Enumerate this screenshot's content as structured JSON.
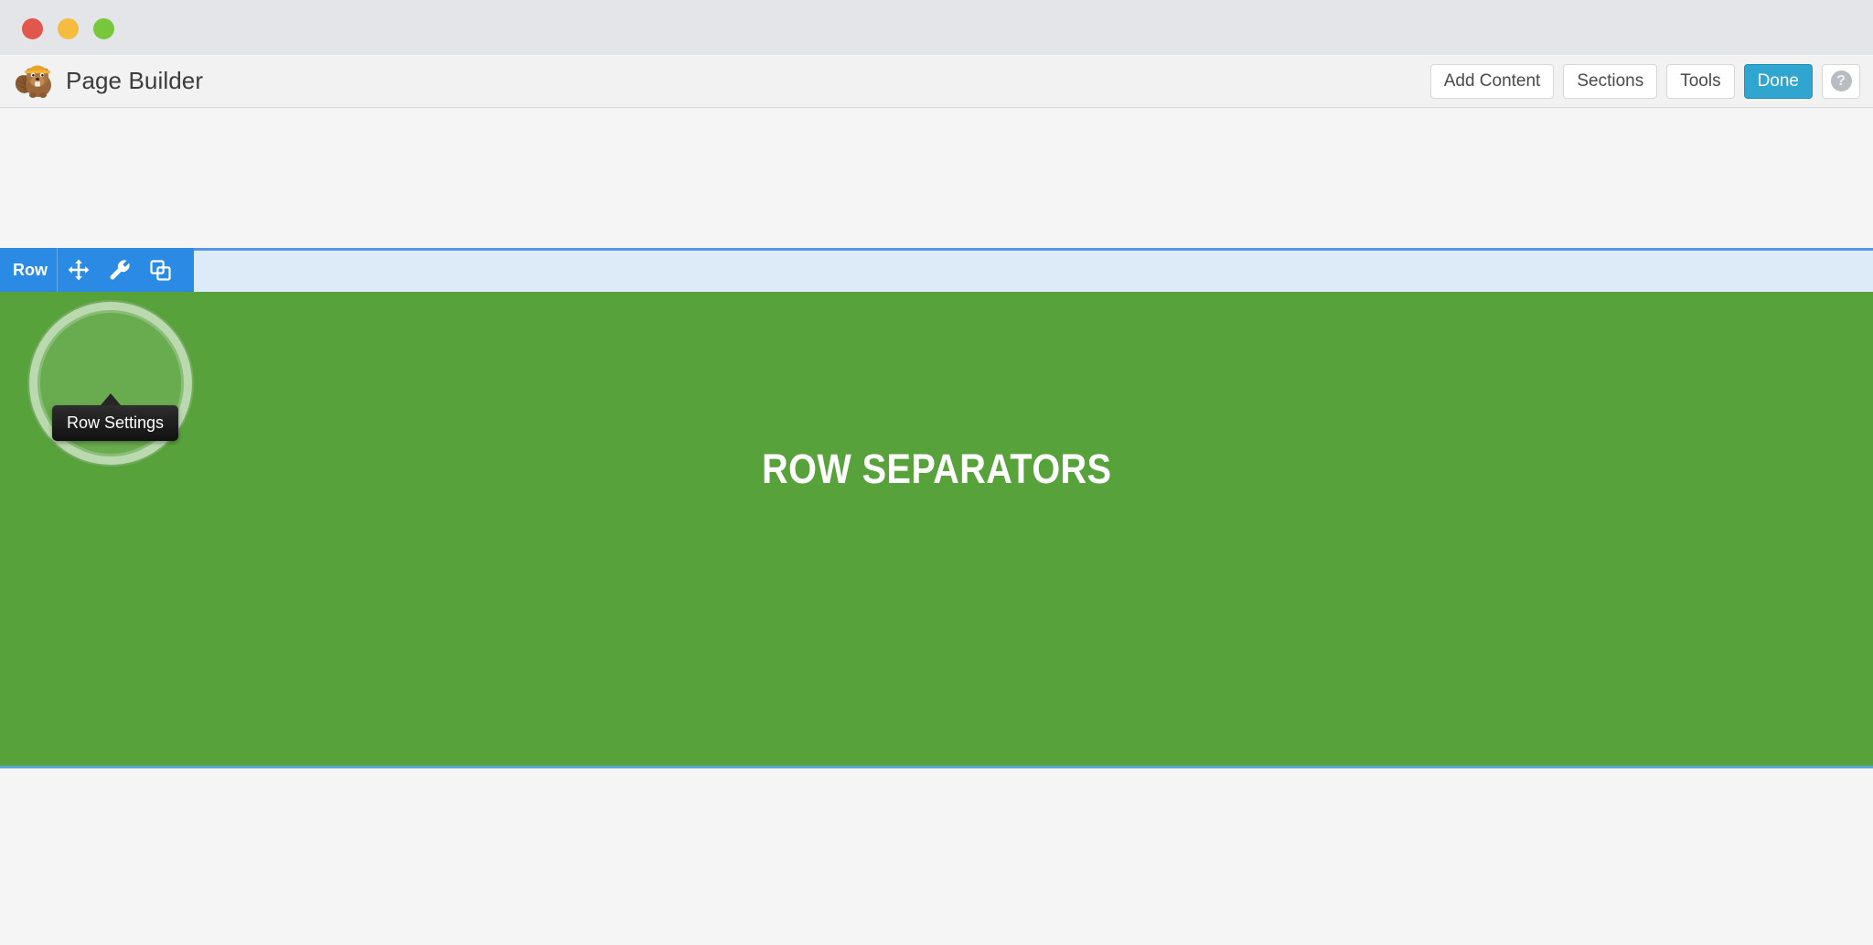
{
  "window": {
    "traffic_lights": [
      {
        "name": "close",
        "color": "#e2574c"
      },
      {
        "name": "minimize",
        "color": "#f6bc40"
      },
      {
        "name": "maximize",
        "color": "#77c73c"
      }
    ]
  },
  "header": {
    "brand_title": "Page Builder",
    "logo_icon": "beaver-logo-icon",
    "actions": [
      {
        "label": "Add Content",
        "name": "add-content-button",
        "primary": false
      },
      {
        "label": "Sections",
        "name": "sections-button",
        "primary": false
      },
      {
        "label": "Tools",
        "name": "tools-button",
        "primary": false
      },
      {
        "label": "Done",
        "name": "done-button",
        "primary": true
      }
    ],
    "help_button": {
      "label": "?",
      "name": "help-button",
      "icon": "question-circle-icon"
    }
  },
  "canvas": {
    "background_color": "#f5f5f5",
    "row": {
      "label": "Row",
      "heading": "ROW SEPARATORS",
      "background_color": "#58a23c",
      "highlight_strip_color": "#ddeaf7",
      "outline_color": "#5596e6",
      "toolbar": {
        "background_color": "#2a8ae4",
        "buttons": [
          {
            "name": "row-move-icon",
            "icon": "move-arrows-icon",
            "title": "Move Row"
          },
          {
            "name": "row-settings-icon",
            "icon": "wrench-icon",
            "title": "Row Settings"
          },
          {
            "name": "row-duplicate-icon",
            "icon": "copy-icon",
            "title": "Duplicate Row"
          },
          {
            "name": "row-delete-icon",
            "icon": "close-x-icon",
            "title": "Delete Row"
          }
        ]
      }
    }
  },
  "tooltip": {
    "text": "Row Settings"
  }
}
